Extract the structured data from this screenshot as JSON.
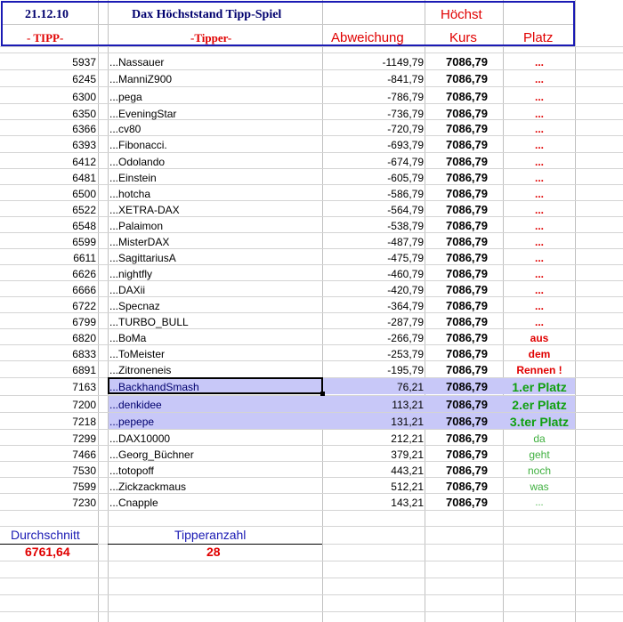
{
  "header": {
    "date": "21.12.10",
    "title": "Dax Höchststand Tipp-Spiel",
    "hoechst": "Höchst",
    "col_tipp": "- TIPP-",
    "col_tipper": "-Tipper-",
    "col_abweichung": "Abweichung",
    "col_kurs": "Kurs",
    "col_platz": "Platz"
  },
  "rows": [
    {
      "tipp": "5937",
      "name": "...Nassauer",
      "abw": "-1149,79",
      "kurs": "7086,79",
      "platz": "..."
    },
    {
      "tipp": "6245",
      "name": "...ManniZ900",
      "abw": "-841,79",
      "kurs": "7086,79",
      "platz": "..."
    },
    {
      "tipp": "6300",
      "name": "...pega",
      "abw": "-786,79",
      "kurs": "7086,79",
      "platz": "..."
    },
    {
      "tipp": "6350",
      "name": "...EveningStar",
      "abw": "-736,79",
      "kurs": "7086,79",
      "platz": "..."
    },
    {
      "tipp": "6366",
      "name": "...cv80",
      "abw": "-720,79",
      "kurs": "7086,79",
      "platz": "..."
    },
    {
      "tipp": "6393",
      "name": "...Fibonacci.",
      "abw": "-693,79",
      "kurs": "7086,79",
      "platz": "..."
    },
    {
      "tipp": "6412",
      "name": "...Odolando",
      "abw": "-674,79",
      "kurs": "7086,79",
      "platz": "..."
    },
    {
      "tipp": "6481",
      "name": "...Einstein",
      "abw": "-605,79",
      "kurs": "7086,79",
      "platz": "..."
    },
    {
      "tipp": "6500",
      "name": "...hotcha",
      "abw": "-586,79",
      "kurs": "7086,79",
      "platz": "..."
    },
    {
      "tipp": "6522",
      "name": "...XETRA-DAX",
      "abw": "-564,79",
      "kurs": "7086,79",
      "platz": "..."
    },
    {
      "tipp": "6548",
      "name": "...Palaimon",
      "abw": "-538,79",
      "kurs": "7086,79",
      "platz": "..."
    },
    {
      "tipp": "6599",
      "name": "...MisterDAX",
      "abw": "-487,79",
      "kurs": "7086,79",
      "platz": "..."
    },
    {
      "tipp": "6611",
      "name": "...SagittariusA",
      "abw": "-475,79",
      "kurs": "7086,79",
      "platz": "..."
    },
    {
      "tipp": "6626",
      "name": "...nightfly",
      "abw": "-460,79",
      "kurs": "7086,79",
      "platz": "..."
    },
    {
      "tipp": "6666",
      "name": "...DAXii",
      "abw": "-420,79",
      "kurs": "7086,79",
      "platz": "..."
    },
    {
      "tipp": "6722",
      "name": "...Specnaz",
      "abw": "-364,79",
      "kurs": "7086,79",
      "platz": "..."
    },
    {
      "tipp": "6799",
      "name": "...TURBO_BULL",
      "abw": "-287,79",
      "kurs": "7086,79",
      "platz": "..."
    },
    {
      "tipp": "6820",
      "name": "...BoMa",
      "abw": "-266,79",
      "kurs": "7086,79",
      "platz": "aus"
    },
    {
      "tipp": "6833",
      "name": "...ToMeister",
      "abw": "-253,79",
      "kurs": "7086,79",
      "platz": "dem"
    },
    {
      "tipp": "6891",
      "name": "...Zitroneneis",
      "abw": "-195,79",
      "kurs": "7086,79",
      "platz": "Rennen !"
    },
    {
      "tipp": "7163",
      "name": "...BackhandSmash",
      "abw": "76,21",
      "kurs": "7086,79",
      "platz": "1.er Platz"
    },
    {
      "tipp": "7200",
      "name": "...denkidee",
      "abw": "113,21",
      "kurs": "7086,79",
      "platz": "2.er Platz"
    },
    {
      "tipp": "7218",
      "name": "...pepepe",
      "abw": "131,21",
      "kurs": "7086,79",
      "platz": "3.ter Platz"
    },
    {
      "tipp": "7299",
      "name": "...DAX10000",
      "abw": "212,21",
      "kurs": "7086,79",
      "platz": "da"
    },
    {
      "tipp": "7466",
      "name": "...Georg_Büchner",
      "abw": "379,21",
      "kurs": "7086,79",
      "platz": "geht"
    },
    {
      "tipp": "7530",
      "name": "...totopoff",
      "abw": "443,21",
      "kurs": "7086,79",
      "platz": "noch"
    },
    {
      "tipp": "7599",
      "name": "...Zickzackmaus",
      "abw": "512,21",
      "kurs": "7086,79",
      "platz": "was"
    },
    {
      "tipp": "7230",
      "name": "...Cnapple",
      "abw": "143,21",
      "kurs": "7086,79",
      "platz": "..."
    }
  ],
  "footer": {
    "durchschnitt_label": "Durchschnitt",
    "durchschnitt_value": "6761,64",
    "tipperanzahl_label": "Tipperanzahl",
    "tipperanzahl_value": "28"
  },
  "colors": {
    "red": "#e00000",
    "green_winner": "#10a010",
    "green_light": "#40b040",
    "highlight": "#c8c8f8",
    "header_border": "#1a1ab4",
    "navy": "#00006e"
  }
}
